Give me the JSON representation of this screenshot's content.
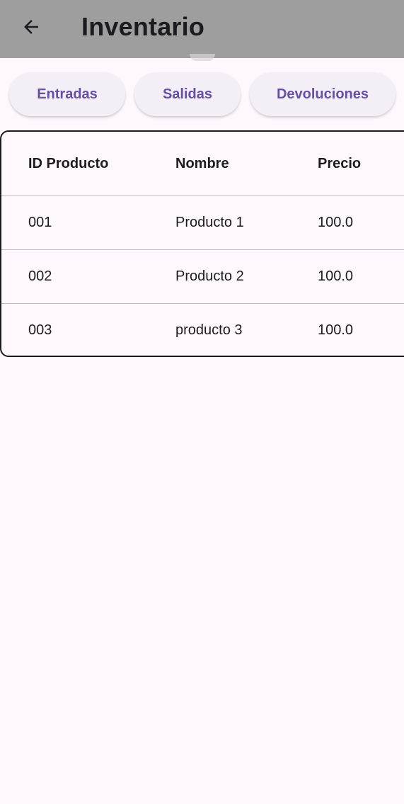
{
  "app_bar": {
    "title": "Inventario",
    "back_icon": "arrow-left-icon",
    "background": "#9e9e9e"
  },
  "actions": [
    {
      "label": "Entradas"
    },
    {
      "label": "Salidas"
    },
    {
      "label": "Devoluciones"
    }
  ],
  "accent_color": "#6750a4",
  "table": {
    "headers": [
      "ID Producto",
      "Nombre",
      "Precio"
    ],
    "rows": [
      [
        "001",
        "Producto 1",
        "100.0"
      ],
      [
        "002",
        "Producto 2",
        "100.0"
      ],
      [
        "003",
        "producto 3",
        "100.0"
      ]
    ]
  }
}
